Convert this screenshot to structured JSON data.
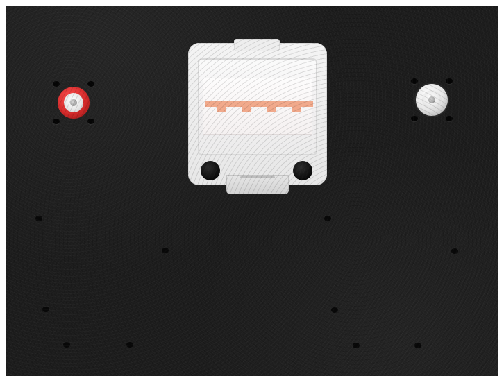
{
  "scene": {
    "description_label": "",
    "jack_left": {
      "ring_color": "#d42a2a",
      "kind": "rca-jack-red"
    },
    "jack_right": {
      "ring_color": "#e8e8e8",
      "kind": "rca-jack-white"
    },
    "connector": {
      "contact_color": "#f0a07e",
      "kind": "pcb-edge-connector"
    },
    "panel_color": "#1b1b1b"
  }
}
